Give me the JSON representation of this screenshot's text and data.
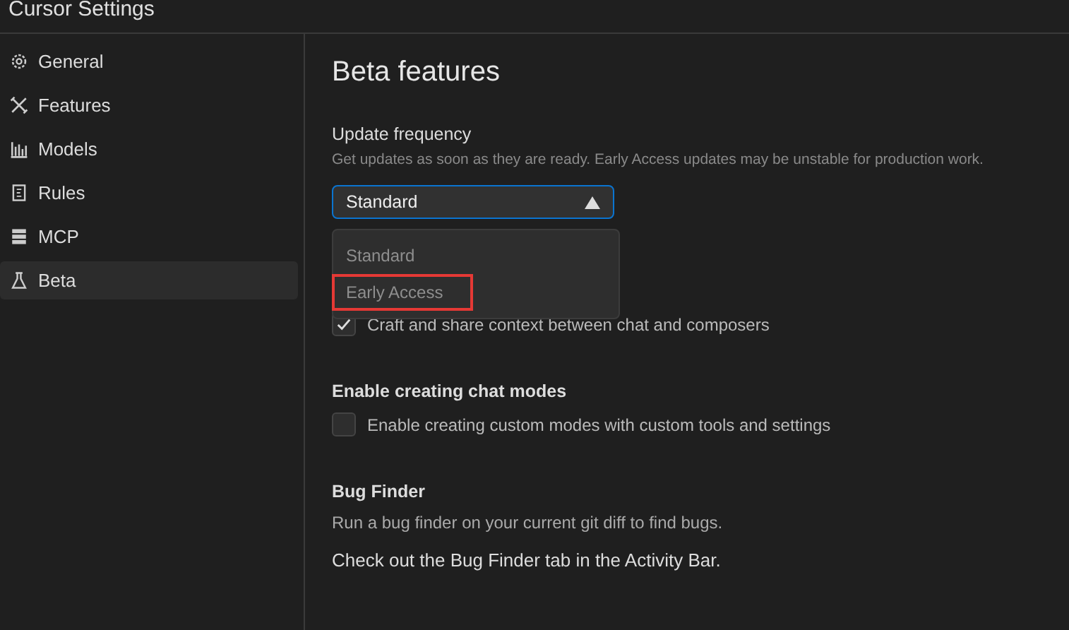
{
  "window": {
    "title": "Cursor Settings"
  },
  "sidebar": {
    "items": [
      {
        "label": "General",
        "selected": false
      },
      {
        "label": "Features",
        "selected": false
      },
      {
        "label": "Models",
        "selected": false
      },
      {
        "label": "Rules",
        "selected": false
      },
      {
        "label": "MCP",
        "selected": false
      },
      {
        "label": "Beta",
        "selected": true
      }
    ]
  },
  "page": {
    "title": "Beta features",
    "update_frequency": {
      "label": "Update frequency",
      "description": "Get updates as soon as they are ready. Early Access updates may be unstable for production work.",
      "value": "Standard",
      "expanded": true,
      "options": [
        {
          "label": "Standard",
          "highlighted": false
        },
        {
          "label": "Early Access",
          "highlighted": true
        }
      ]
    },
    "sections": [
      {
        "kind": "checkbox",
        "text": "Craft and share context between chat and composers",
        "checked": true
      },
      {
        "kind": "checkbox",
        "heading": "Enable creating chat modes",
        "text": "Enable creating custom modes with custom tools and settings",
        "checked": false
      },
      {
        "kind": "info",
        "heading": "Bug Finder",
        "text": "Run a bug finder on your current git diff to find bugs.",
        "note": "Check out the Bug Finder tab in the Activity Bar."
      }
    ]
  }
}
